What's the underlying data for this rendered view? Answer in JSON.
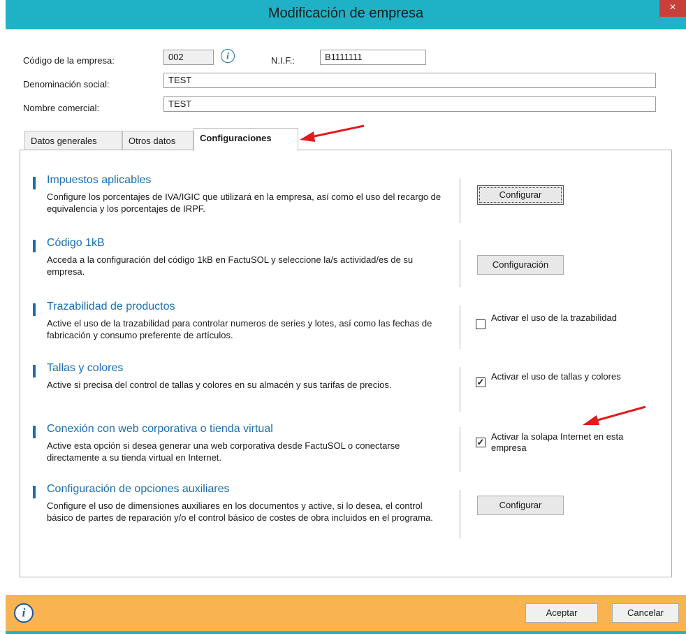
{
  "window": {
    "title": "Modificación de empresa",
    "close_glyph": "×"
  },
  "header": {
    "codigo_label": "Código de la empresa:",
    "codigo_value": "002",
    "nif_label": "N.I.F.:",
    "nif_value": "B1111111",
    "denominacion_label": "Denominación social:",
    "denominacion_value": "TEST",
    "nombre_label": "Nombre comercial:",
    "nombre_value": "TEST"
  },
  "tabs": [
    {
      "label": "Datos generales"
    },
    {
      "label": "Otros datos"
    },
    {
      "label": "Configuraciones"
    }
  ],
  "sections": [
    {
      "title": "Impuestos aplicables",
      "desc": "Configure los porcentajes de IVA/IGIC que utilizará en la empresa, así como el uso del recargo de equivalencia y los porcentajes de IRPF.",
      "button": "Configurar"
    },
    {
      "title": "Código 1kB",
      "desc": "Acceda a la configuración del código 1kB en FactuSOL y seleccione la/s actividad/es de su empresa.",
      "button": "Configuración"
    },
    {
      "title": "Trazabilidad de productos",
      "desc": "Active el uso de la trazabilidad para controlar numeros de series y lotes, así como las fechas de fabricación y consumo preferente de artículos.",
      "checkbox": "Activar el uso de la trazabilidad",
      "checked": false
    },
    {
      "title": "Tallas y colores",
      "desc": "Active si precisa del control de tallas y colores en su almacén y sus tarifas de precios.",
      "checkbox": "Activar el uso de tallas y colores",
      "checked": true
    },
    {
      "title": "Conexión con web corporativa o tienda virtual",
      "desc": "Active esta opción si desea generar una web corporativa desde FactuSOL o conectarse directamente a su tienda virtual en Internet.",
      "checkbox": "Activar la solapa Internet en esta empresa",
      "checked": true
    },
    {
      "title": "Configuración de opciones auxiliares",
      "desc": "Configure el uso de dimensiones auxiliares en los documentos y active, si lo desea, el control básico de partes de reparación y/o el control básico de costes de obra incluidos en el programa.",
      "button": "Configurar"
    }
  ],
  "footer": {
    "info_glyph": "i",
    "accept": "Aceptar",
    "cancel": "Cancelar"
  },
  "colors": {
    "titlebar": "#1fb2c6",
    "footer": "#f9b350",
    "accent": "#1a6fb0",
    "arrow": "#e01b1b"
  }
}
